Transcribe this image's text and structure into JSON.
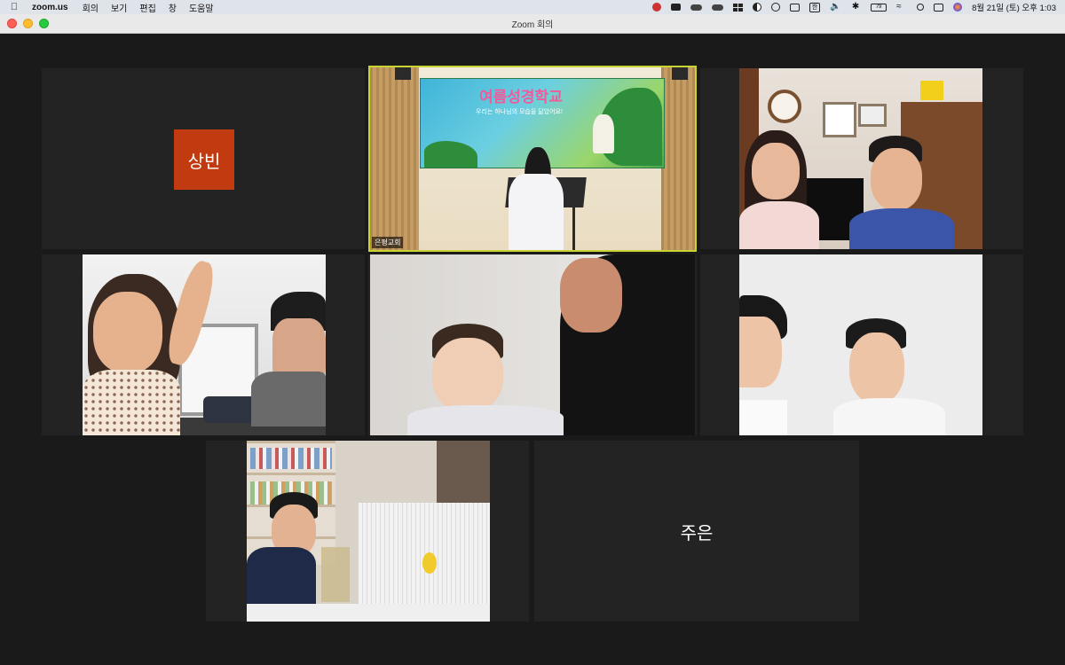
{
  "menubar": {
    "app_name": "zoom.us",
    "menus": [
      "회의",
      "보기",
      "편집",
      "창",
      "도움말"
    ],
    "battery_label": "79",
    "input_method": "한",
    "clock": "8월 21일 (토) 오후 1:03"
  },
  "window": {
    "title": "Zoom 회의"
  },
  "participants": {
    "sangbin": {
      "avatar_text": "상빈"
    },
    "church": {
      "name": "은평교회"
    },
    "banner": {
      "title": "여름성경학교",
      "subtitle": "우리는 하나님의 모습을 닮았어요!"
    },
    "jueun": {
      "name": "주은"
    }
  }
}
